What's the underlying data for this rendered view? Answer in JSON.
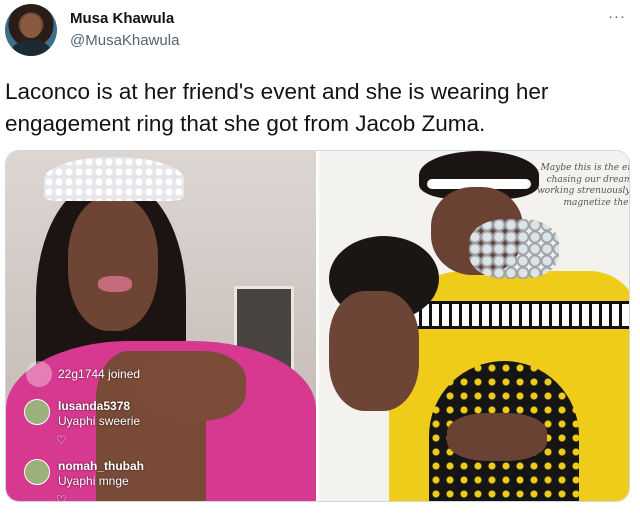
{
  "tweet": {
    "author_name": "Musa Khawula",
    "author_handle": "@MusaKhawula",
    "more_glyph": "···",
    "text": "Laconco is at her friend's event and she is wearing her engagement ring that she got from Jacob Zuma."
  },
  "media": {
    "left_image": {
      "live_overlay": {
        "join_text": "22g1744 joined",
        "comments": [
          {
            "user": "lusanda5378",
            "text": "Uyaphi sweerie",
            "heart": "♡"
          },
          {
            "user": "nomah_thubah",
            "text": "Uyaphi mnge",
            "heart": "♡"
          }
        ]
      }
    },
    "right_image": {
      "caption_lines": [
        "Maybe this is the era",
        "chasing our dreams",
        "working strenuously t",
        "magnetize them"
      ]
    }
  }
}
